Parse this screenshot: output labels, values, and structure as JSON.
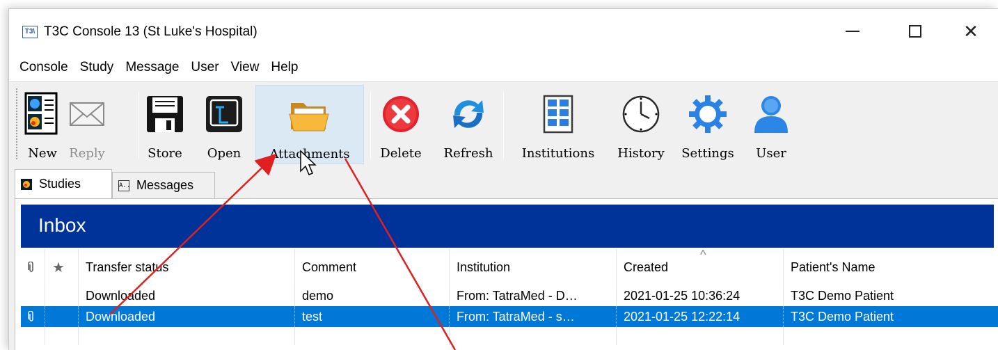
{
  "window": {
    "app_icon_text": "T3\\",
    "title": "T3C Console 13 (St Luke's Hospital)"
  },
  "menu": [
    "Console",
    "Study",
    "Message",
    "User",
    "View",
    "Help"
  ],
  "toolbar": {
    "new": "New",
    "reply": "Reply",
    "store": "Store",
    "open": "Open",
    "attachments": "Attachments",
    "delete": "Delete",
    "refresh": "Refresh",
    "institutions": "Institutions",
    "history": "History",
    "settings": "Settings",
    "user": "User"
  },
  "tabs": {
    "studies": "Studies",
    "messages": "Messages",
    "messages_icon": "A.."
  },
  "inbox": {
    "title": "Inbox"
  },
  "table": {
    "headers": [
      "Transfer status",
      "Comment",
      "Institution",
      "Created",
      "Patient's Name"
    ],
    "sort_column": "Created",
    "rows": [
      {
        "status": "Downloaded",
        "comment": "demo",
        "institution": "From: TatraMed - D…",
        "created": "2021-01-25 10:36:24",
        "patient": "T3C Demo Patient",
        "selected": false
      },
      {
        "status": "Downloaded",
        "comment": "test",
        "institution": "From: TatraMed - s…",
        "created": "2021-01-25 12:22:14",
        "patient": "T3C Demo Patient",
        "selected": true
      }
    ]
  },
  "colors": {
    "inbox_header": "#003399",
    "selection": "#0078d7",
    "annotation_arrow": "#e02020"
  }
}
